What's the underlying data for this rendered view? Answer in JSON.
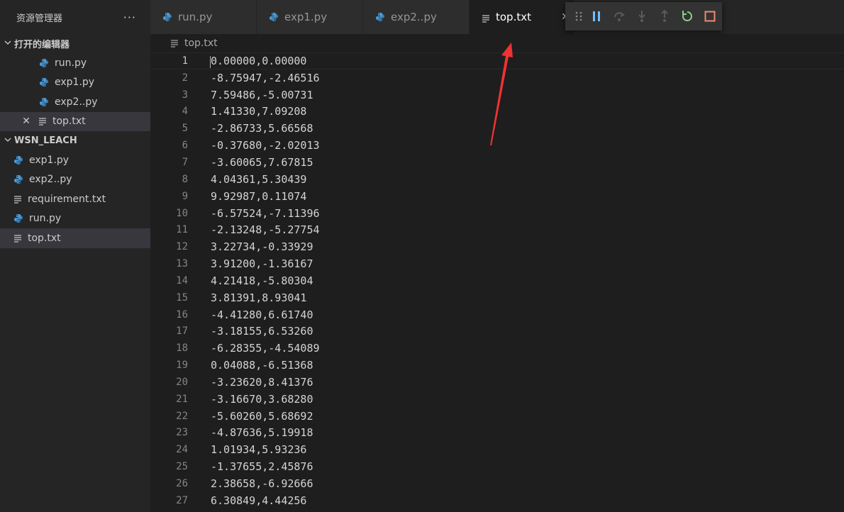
{
  "sidebar": {
    "title": "资源管理器",
    "more_label": "···",
    "open_editors": {
      "label": "打开的编辑器",
      "items": [
        {
          "name": "run.py",
          "type": "py"
        },
        {
          "name": "exp1.py",
          "type": "py"
        },
        {
          "name": "exp2..py",
          "type": "py"
        },
        {
          "name": "top.txt",
          "type": "txt",
          "close": "✕"
        }
      ]
    },
    "workspace": {
      "label": "WSN_LEACH",
      "items": [
        {
          "name": "exp1.py",
          "type": "py"
        },
        {
          "name": "exp2..py",
          "type": "py"
        },
        {
          "name": "requirement.txt",
          "type": "txt"
        },
        {
          "name": "run.py",
          "type": "py"
        },
        {
          "name": "top.txt",
          "type": "txt"
        }
      ]
    }
  },
  "tabs": [
    {
      "label": "run.py",
      "type": "py"
    },
    {
      "label": "exp1.py",
      "type": "py"
    },
    {
      "label": "exp2..py",
      "type": "py"
    },
    {
      "label": "top.txt",
      "type": "txt",
      "active": true,
      "close": "✕"
    }
  ],
  "debug_toolbar": {
    "buttons": [
      "drag-handle",
      "pause",
      "step-over",
      "step-into",
      "step-out",
      "restart",
      "stop"
    ],
    "colors": {
      "pause": "#75beff",
      "restart": "#89d185",
      "stop": "#f48771",
      "disabled": "#5a5a5a"
    }
  },
  "breadcrumb": {
    "file": "top.txt"
  },
  "editor": {
    "lines": [
      {
        "n": "1",
        "text": "0.00000,0.00000"
      },
      {
        "n": "2",
        "text": "-8.75947,-2.46516"
      },
      {
        "n": "3",
        "text": "7.59486,-5.00731"
      },
      {
        "n": "4",
        "text": "1.41330,7.09208"
      },
      {
        "n": "5",
        "text": "-2.86733,5.66568"
      },
      {
        "n": "6",
        "text": "-0.37680,-2.02013"
      },
      {
        "n": "7",
        "text": "-3.60065,7.67815"
      },
      {
        "n": "8",
        "text": "4.04361,5.30439"
      },
      {
        "n": "9",
        "text": "9.92987,0.11074"
      },
      {
        "n": "10",
        "text": "-6.57524,-7.11396"
      },
      {
        "n": "11",
        "text": "-2.13248,-5.27754"
      },
      {
        "n": "12",
        "text": "3.22734,-0.33929"
      },
      {
        "n": "13",
        "text": "3.91200,-1.36167"
      },
      {
        "n": "14",
        "text": "4.21418,-5.80304"
      },
      {
        "n": "15",
        "text": "3.81391,8.93041"
      },
      {
        "n": "16",
        "text": "-4.41280,6.61740"
      },
      {
        "n": "17",
        "text": "-3.18155,6.53260"
      },
      {
        "n": "18",
        "text": "-6.28355,-4.54089"
      },
      {
        "n": "19",
        "text": "0.04088,-6.51368"
      },
      {
        "n": "20",
        "text": "-3.23620,8.41376"
      },
      {
        "n": "21",
        "text": "-3.16670,3.68280"
      },
      {
        "n": "22",
        "text": "-5.60260,5.68692"
      },
      {
        "n": "23",
        "text": "-4.87636,5.19918"
      },
      {
        "n": "24",
        "text": "1.01934,5.93236"
      },
      {
        "n": "25",
        "text": "-1.37655,2.45876"
      },
      {
        "n": "26",
        "text": "2.38658,-6.92666"
      },
      {
        "n": "27",
        "text": "6.30849,4.44256"
      }
    ]
  },
  "annotation": {
    "arrow_color": "#f03232"
  }
}
